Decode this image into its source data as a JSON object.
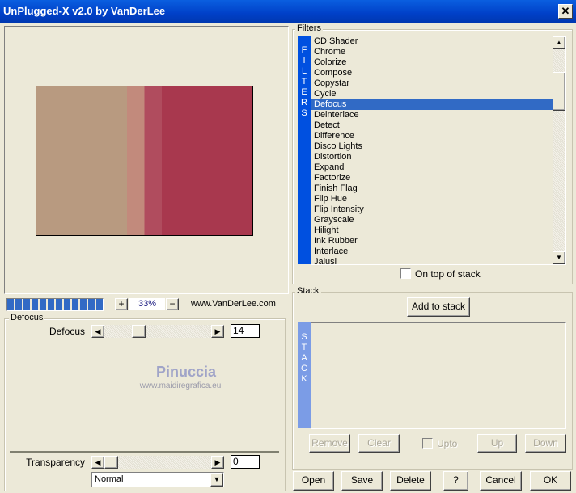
{
  "window": {
    "title": "UnPlugged-X v2.0 by VanDerLee",
    "close": "✕"
  },
  "preview": {
    "image_colors": [
      "#b89a80",
      "#c28a7c",
      "#b04c5e",
      "#a8384e"
    ],
    "zoom": "33%",
    "zoom_in": "+",
    "zoom_out": "−",
    "progress_percent": 100,
    "url": "www.VanDerLee.com"
  },
  "settings": {
    "group": "Defocus",
    "slider_label": "Defocus",
    "slider_value": "14",
    "slider_fraction": 0.14,
    "watermark_name": "Pinuccia",
    "watermark_url": "www.maidiregrafica.eu",
    "transparency_label": "Transparency",
    "transparency_value": "0",
    "blend_mode": "Normal"
  },
  "filters": {
    "group": "Filters",
    "strip": [
      "F",
      "I",
      "L",
      "T",
      "E",
      "R",
      "S"
    ],
    "items": [
      "CD Shader",
      "Chrome",
      "Colorize",
      "Compose",
      "Copystar",
      "Cycle",
      "Defocus",
      "Deinterlace",
      "Detect",
      "Difference",
      "Disco Lights",
      "Distortion",
      "Expand",
      "Factorize",
      "Finish Flag",
      "Flip Hue",
      "Flip Intensity",
      "Grayscale",
      "Hilight",
      "Ink Rubber",
      "Interlace",
      "Jalusi"
    ],
    "selected": "Defocus",
    "on_top_label": "On top of stack"
  },
  "stack": {
    "group": "Stack",
    "add": "Add to stack",
    "strip": [
      "S",
      "T",
      "A",
      "C",
      "K"
    ],
    "remove": "Remove",
    "clear": "Clear",
    "upto": "Upto",
    "up": "Up",
    "down": "Down"
  },
  "footer": {
    "open": "Open",
    "save": "Save",
    "delete": "Delete",
    "help": "?",
    "cancel": "Cancel",
    "ok": "OK"
  },
  "colors": {
    "accent": "#316AC5",
    "strip": "#0050E0"
  }
}
